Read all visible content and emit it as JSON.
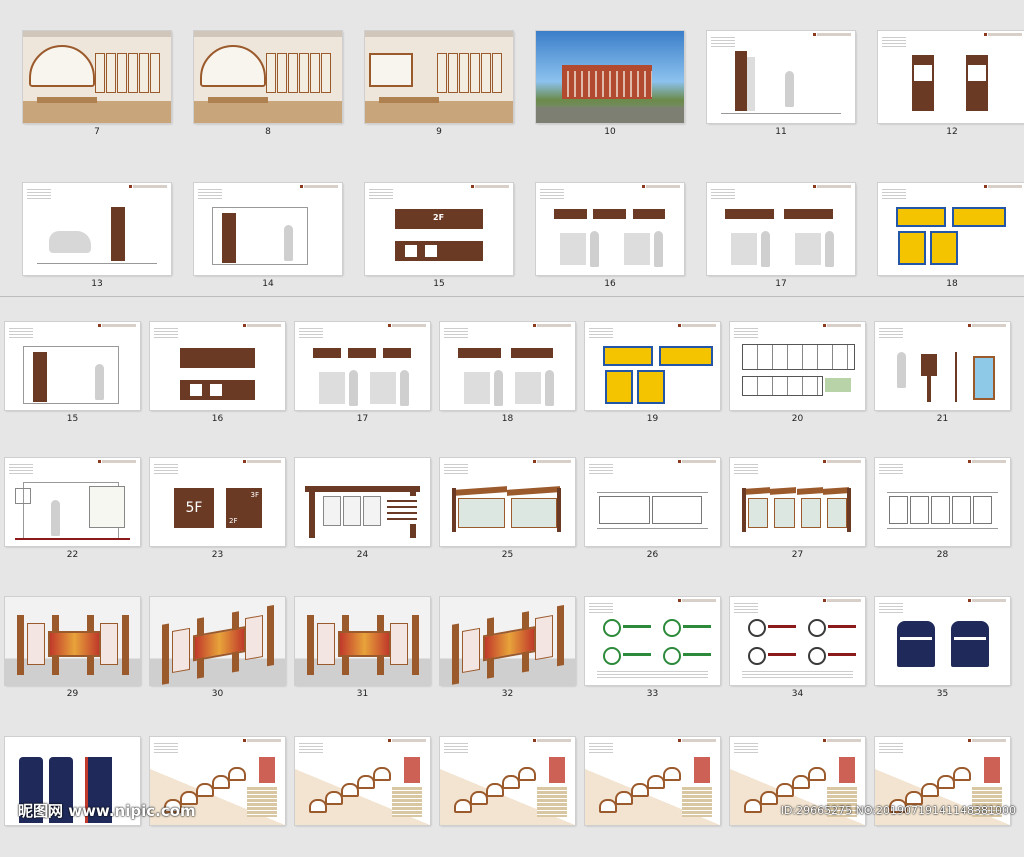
{
  "row1": [
    {
      "num": "7",
      "kind": "wall-fan"
    },
    {
      "num": "8",
      "kind": "wall-fan-large"
    },
    {
      "num": "9",
      "kind": "wall-scroll"
    },
    {
      "num": "10",
      "kind": "photo-building"
    },
    {
      "num": "11",
      "kind": "pylon-person"
    },
    {
      "num": "12",
      "kind": "twin-pylons"
    }
  ],
  "row2": [
    {
      "num": "13",
      "kind": "car-pylon"
    },
    {
      "num": "14",
      "kind": "panel-person"
    },
    {
      "num": "15",
      "kind": "hanging-signs",
      "floor_text": "2F"
    },
    {
      "num": "16",
      "kind": "door-signs"
    },
    {
      "num": "17",
      "kind": "door-signs-b"
    },
    {
      "num": "18",
      "kind": "warning-signs"
    }
  ],
  "row3": [
    {
      "num": "15",
      "kind": "panel-person"
    },
    {
      "num": "16",
      "kind": "hanging-signs"
    },
    {
      "num": "17",
      "kind": "door-signs"
    },
    {
      "num": "18",
      "kind": "door-signs-b"
    },
    {
      "num": "19",
      "kind": "warning-signs"
    },
    {
      "num": "20",
      "kind": "display-case"
    },
    {
      "num": "21",
      "kind": "lamp-sign"
    }
  ],
  "row4": [
    {
      "num": "22",
      "kind": "board-person"
    },
    {
      "num": "23",
      "kind": "floor-signs",
      "floor_5f": "5F",
      "floor_3f": "3F",
      "floor_2f": "2F"
    },
    {
      "num": "24",
      "kind": "bulletin-board"
    },
    {
      "num": "25",
      "kind": "pavilion"
    },
    {
      "num": "26",
      "kind": "pavilion-line"
    },
    {
      "num": "27",
      "kind": "pavilion-long"
    },
    {
      "num": "28",
      "kind": "pavilion-line-long"
    }
  ],
  "row5": [
    {
      "num": "29",
      "kind": "party-wall-front"
    },
    {
      "num": "30",
      "kind": "party-wall-angle"
    },
    {
      "num": "31",
      "kind": "party-wall-close"
    },
    {
      "num": "32",
      "kind": "party-wall-angle2"
    },
    {
      "num": "33",
      "kind": "logo-sheet"
    },
    {
      "num": "34",
      "kind": "logo-sheet-b"
    },
    {
      "num": "35",
      "kind": "jacket"
    }
  ],
  "row6": [
    {
      "num": "",
      "kind": "pants"
    },
    {
      "num": "",
      "kind": "stair-wall"
    },
    {
      "num": "",
      "kind": "stair-wall"
    },
    {
      "num": "",
      "kind": "stair-wall"
    },
    {
      "num": "",
      "kind": "stair-wall"
    },
    {
      "num": "",
      "kind": "stair-wall"
    },
    {
      "num": "",
      "kind": "stair-wall"
    }
  ],
  "watermark": "ID:29665275 NO:20190719141148381000",
  "site_logo": "昵图网 www.nipic.com",
  "colors": {
    "brown": "#6b3a24",
    "wood": "#9b5a2c",
    "red": "#c0392b",
    "yellow": "#f5c400",
    "navy": "#1f2a5a"
  }
}
